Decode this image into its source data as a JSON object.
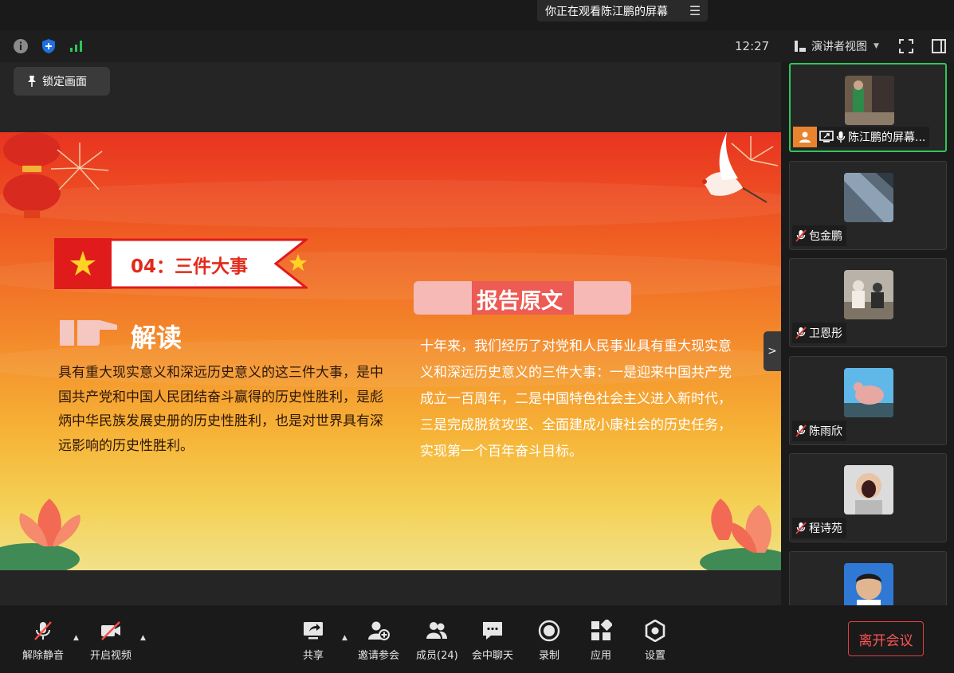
{
  "notice": {
    "text": "你正在观看陈江鹏的屏幕"
  },
  "status": {
    "clock": "12:27",
    "view_menu_label": "演讲者视图"
  },
  "stage": {
    "lock_label": "锁定画面"
  },
  "slide": {
    "banner_title": "04：三件大事",
    "jiedu_title": "解读",
    "jiedu_text": "具有重大现实意义和深远历史意义的这三件大事，是中国共产党和中国人民团结奋斗赢得的历史性胜利，是彪炳中华民族发展史册的历史性胜利，也是对世界具有深远影响的历史性胜利。",
    "report_title": "报告原文",
    "report_text": "十年来，我们经历了对党和人民事业具有重大现实意义和深远历史意义的三件大事：一是迎来中国共产党成立一百周年，二是中国特色社会主义进入新时代，三是完成脱贫攻坚、全面建成小康社会的历史任务，实现第一个百年奋斗目标。"
  },
  "participants": [
    {
      "name": "陈江鹏的屏幕...",
      "active": true,
      "host": true
    },
    {
      "name": "包金鹏"
    },
    {
      "name": "卫恩彤"
    },
    {
      "name": "陈雨欣"
    },
    {
      "name": "程诗苑"
    },
    {
      "name": ""
    }
  ],
  "toolbar": {
    "mute_label": "解除静音",
    "video_label": "开启视频",
    "share_label": "共享",
    "invite_label": "邀请参会",
    "members_label": "成员(24)",
    "chat_label": "会中聊天",
    "record_label": "录制",
    "apps_label": "应用",
    "settings_label": "设置",
    "leave_label": "离开会议"
  },
  "colors": {
    "accent_green": "#2fc65a",
    "leave_red": "#ff5454",
    "host_orange": "#e8832e"
  }
}
